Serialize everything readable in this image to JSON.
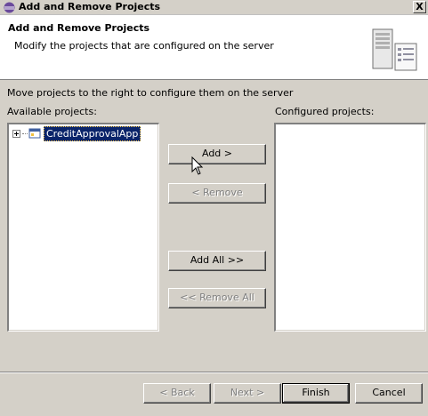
{
  "window": {
    "title": "Add and Remove Projects",
    "close_label": "X"
  },
  "banner": {
    "title": "Add and Remove Projects",
    "description": "Modify the projects that are configured on the server",
    "graphic": "server-icon"
  },
  "instruction": "Move projects to the right to configure them on the server",
  "available": {
    "label": "Available projects:",
    "items": [
      {
        "label": "CreditApprovalApp",
        "selected": true,
        "expandable": true
      }
    ]
  },
  "configured": {
    "label": "Configured projects:",
    "items": []
  },
  "actions": {
    "add": "Add >",
    "remove": "< Remove",
    "add_all": "Add All >>",
    "remove_all": "<< Remove All"
  },
  "footer": {
    "back": "< Back",
    "next": "Next >",
    "finish": "Finish",
    "cancel": "Cancel"
  },
  "colors": {
    "selection": "#0a246a",
    "dialog_bg": "#d4d0c8"
  }
}
